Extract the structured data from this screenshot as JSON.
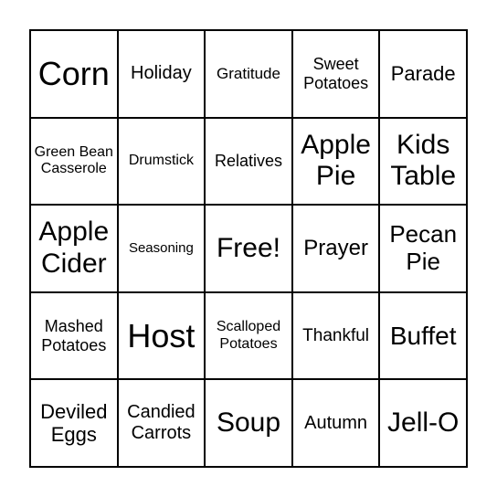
{
  "card": {
    "cells": [
      "Corn",
      "Holiday",
      "Gratitude",
      "Sweet Potatoes",
      "Parade",
      "Green Bean Casserole",
      "Drumstick",
      "Relatives",
      "Apple Pie",
      "Kids Table",
      "Apple Cider",
      "Seasoning",
      "Free!",
      "Prayer",
      "Pecan Pie",
      "Mashed Potatoes",
      "Host",
      "Scalloped Potatoes",
      "Thankful",
      "Buffet",
      "Deviled Eggs",
      "Candied Carrots",
      "Soup",
      "Autumn",
      "Jell-O"
    ]
  }
}
